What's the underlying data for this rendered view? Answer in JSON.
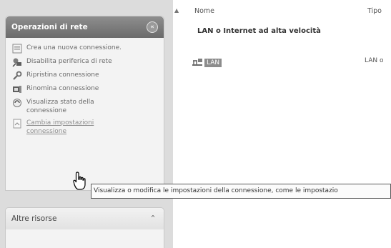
{
  "network_tasks": {
    "title": "Operazioni di rete",
    "collapse_glyph": "«",
    "items": [
      {
        "icon": "new-connection-icon",
        "label": "Crea una nuova connessione."
      },
      {
        "icon": "disable-device-icon",
        "label": "Disabilita periferica di rete"
      },
      {
        "icon": "repair-connection-icon",
        "label": "Ripristina connessione"
      },
      {
        "icon": "rename-connection-icon",
        "label": "Rinomina connessione"
      },
      {
        "icon": "connection-status-icon",
        "label": "Visualizza stato della connessione"
      },
      {
        "icon": "change-settings-icon",
        "label": "Cambia impostazioni connessione"
      }
    ]
  },
  "other_places": {
    "title": "Altre risorse",
    "collapse_glyph": "⌃"
  },
  "list": {
    "col_name": "Nome",
    "col_type": "Tipo",
    "group_title": "LAN o Internet ad alta velocità",
    "item": {
      "name": "LAN",
      "type": "LAN o"
    }
  },
  "tooltip": {
    "text": "Visualizza o modifica le impostazioni della connessione, come le impostazio"
  },
  "colors": {
    "header_dark": "#7a7a7a",
    "pane_bg": "#dcdcdc",
    "selection": "#8c8c8c"
  }
}
